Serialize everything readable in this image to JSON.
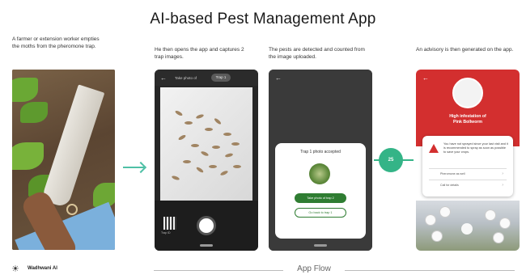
{
  "header": {
    "title": "AI-based Pest Management App"
  },
  "steps": [
    {
      "caption": "A farmer or extension worker empties the moths from the pheromone trap."
    },
    {
      "caption": "He then opens the app and captures 2 trap images."
    },
    {
      "caption": "The pests are detected and counted from the image uploaded."
    },
    {
      "caption": "An advisory is then generated on the app."
    }
  ],
  "phone2": {
    "back_icon": "arrow-left-icon",
    "screen_label": "Take photo of",
    "chip_label": "Trap 1",
    "qr_label": "Trap ID"
  },
  "phone3": {
    "back_icon": "arrow-left-icon",
    "message": "Trap 1 photo accepted",
    "primary_btn": "Take photo of trap 2",
    "secondary_btn": "Go back to trap 1"
  },
  "badge": {
    "label": "25"
  },
  "phone4": {
    "back_icon": "arrow-left-icon",
    "title_line1": "High infestation of",
    "title_line2": "Pink Bollworm",
    "advisory": "You have not sprayed since your last visit and it is recommended to spray as soon as possible to save your crops.",
    "row1": "Pheromone as well",
    "row2": "Call for details"
  },
  "footer": {
    "brand": "Wadhwani AI",
    "flow_label": "App Flow"
  },
  "colors": {
    "accent": "#34b487",
    "alert": "#d32f2f",
    "primary": "#2f7d32"
  }
}
